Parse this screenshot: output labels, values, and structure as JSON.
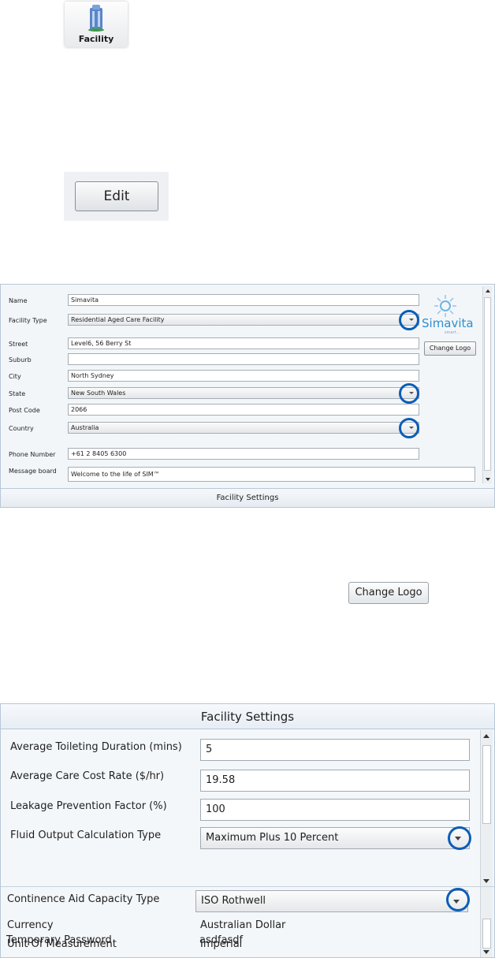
{
  "toolbar": {
    "facility_label": "Facility",
    "edit_label": "Edit"
  },
  "panel1": {
    "labels": {
      "name": "Name",
      "facility_type": "Facility Type",
      "street": "Street",
      "suburb": "Suburb",
      "city": "City",
      "state": "State",
      "post_code": "Post Code",
      "country": "Country",
      "phone": "Phone Number",
      "message": "Message board"
    },
    "values": {
      "name": "Simavita",
      "facility_type": "Residential Aged Care Facility",
      "street": "Level6, 56 Berry St",
      "suburb": "",
      "city": "North Sydney",
      "state": "New South Wales",
      "post_code": "2066",
      "country": "Australia",
      "phone": "+61 2 8405 6300",
      "message": "Welcome to the life of SIM™"
    },
    "logo_text": "Simavita",
    "logo_sub": "smart...",
    "change_logo": "Change Logo",
    "footer": "Facility Settings"
  },
  "change_logo_big": "Change Logo",
  "panel2": {
    "header": "Facility Settings",
    "labels": {
      "toilet": "Average Toileting Duration (mins)",
      "care_cost": "Average Care Cost Rate ($/hr)",
      "leakage": "Leakage Prevention Factor (%)",
      "fluid": "Fluid Output Calculation Type",
      "capacity": "Continence Aid Capacity Type",
      "currency": "Currency",
      "unit": "Unit Of Measurement",
      "password": "Temporary Password"
    },
    "values": {
      "toilet": "5",
      "care_cost": "19.58",
      "leakage": "100",
      "fluid": "Maximum Plus 10 Percent",
      "capacity": "ISO Rothwell",
      "currency": "Australian Dollar",
      "unit": "Imperial",
      "password": "asdfasdf"
    }
  },
  "colors": {
    "highlight_ring": "#0b5db8",
    "panel_border": "#b7c7d8",
    "logo": "#2f8fce"
  }
}
